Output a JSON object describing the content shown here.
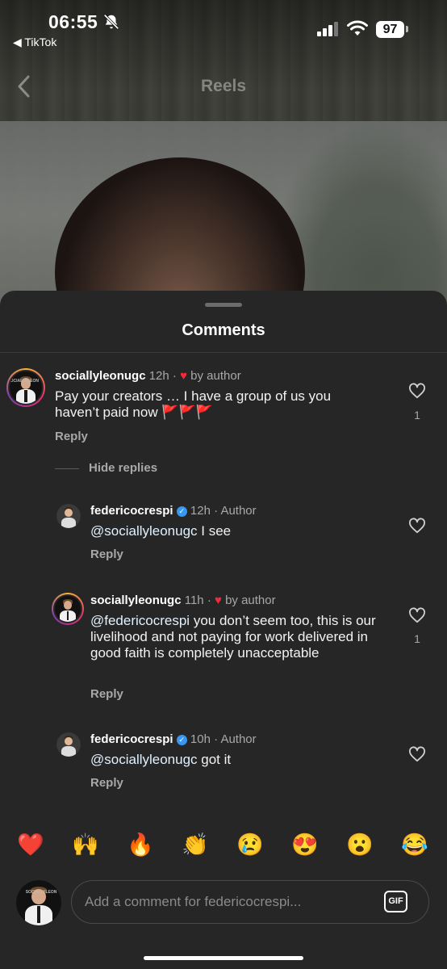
{
  "status_bar": {
    "time": "06:55",
    "back_app": "◀ TikTok",
    "battery": "97"
  },
  "nav": {
    "title": "Reels"
  },
  "sheet": {
    "title": "Comments",
    "hide_replies": "Hide replies"
  },
  "comments": [
    {
      "username": "sociallyleonugc",
      "time": "12h",
      "badge": "by author",
      "text": "Pay your creators … I have a group of us you haven’t paid now 🚩🚩🚩",
      "reply": "Reply",
      "likes": "1"
    }
  ],
  "replies": [
    {
      "username": "federicocrespi",
      "time": "12h",
      "badge": "Author",
      "mention": "@sociallyleonugc",
      "text": " I see",
      "reply": "Reply"
    },
    {
      "username": "sociallyleonugc",
      "time": "11h",
      "badge": "by author",
      "mention": "@federicocrespi",
      "text": " you don’t seem too, this is our livelihood and not paying for work delivered in good faith is completely unacceptable",
      "reply": "Reply",
      "likes": "1"
    },
    {
      "username": "federicocrespi",
      "time": "10h",
      "badge": "Author",
      "mention": "@sociallyleonugc",
      "text": " got it",
      "reply": "Reply"
    }
  ],
  "separator": "·",
  "emoji_bar": [
    "❤️",
    "🙌",
    "🔥",
    "👏",
    "😢",
    "😍",
    "😮",
    "😂"
  ],
  "composer": {
    "placeholder": "Add a comment for federicocrespi...",
    "gif_label": "GIF"
  },
  "colors": {
    "sheet_bg": "#262626",
    "heart_red": "#ed2d3b",
    "verified_blue": "#3897f0",
    "muted": "#a8a8a8"
  }
}
